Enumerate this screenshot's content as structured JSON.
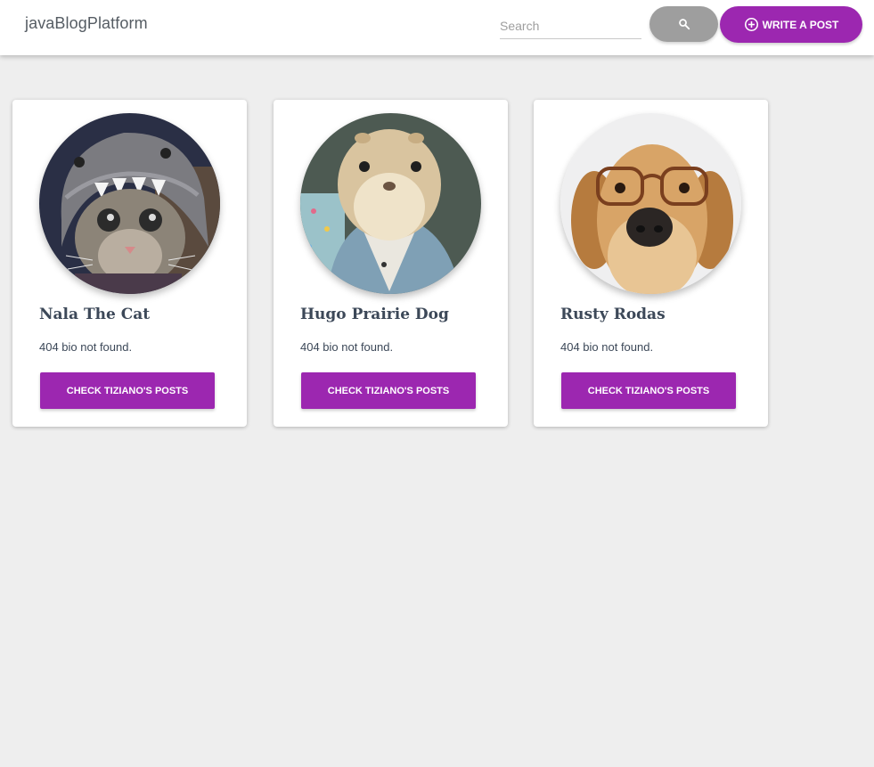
{
  "navbar": {
    "brand": "javaBlogPlatform",
    "search": {
      "placeholder": "Search",
      "value": ""
    },
    "search_button_icon": "search-icon",
    "write_button": {
      "label": "WRITE A POST",
      "icon": "plus-circle-icon"
    }
  },
  "colors": {
    "primary": "#9c27b0",
    "search_button": "#9e9e9e",
    "background": "#eeeeee",
    "card_text": "#3c4858"
  },
  "cards": [
    {
      "name": "Nala The Cat",
      "bio": "404 bio not found.",
      "button": "CHECK TIZIANO'S POSTS",
      "avatar": "cat-in-shark-hoodie-photo"
    },
    {
      "name": "Hugo Prairie Dog",
      "bio": "404 bio not found.",
      "button": "CHECK TIZIANO'S POSTS",
      "avatar": "prairie-dog-in-denim-jacket-photo"
    },
    {
      "name": "Rusty Rodas",
      "bio": "404 bio not found.",
      "button": "CHECK TIZIANO'S POSTS",
      "avatar": "golden-retriever-with-glasses-photo"
    }
  ]
}
